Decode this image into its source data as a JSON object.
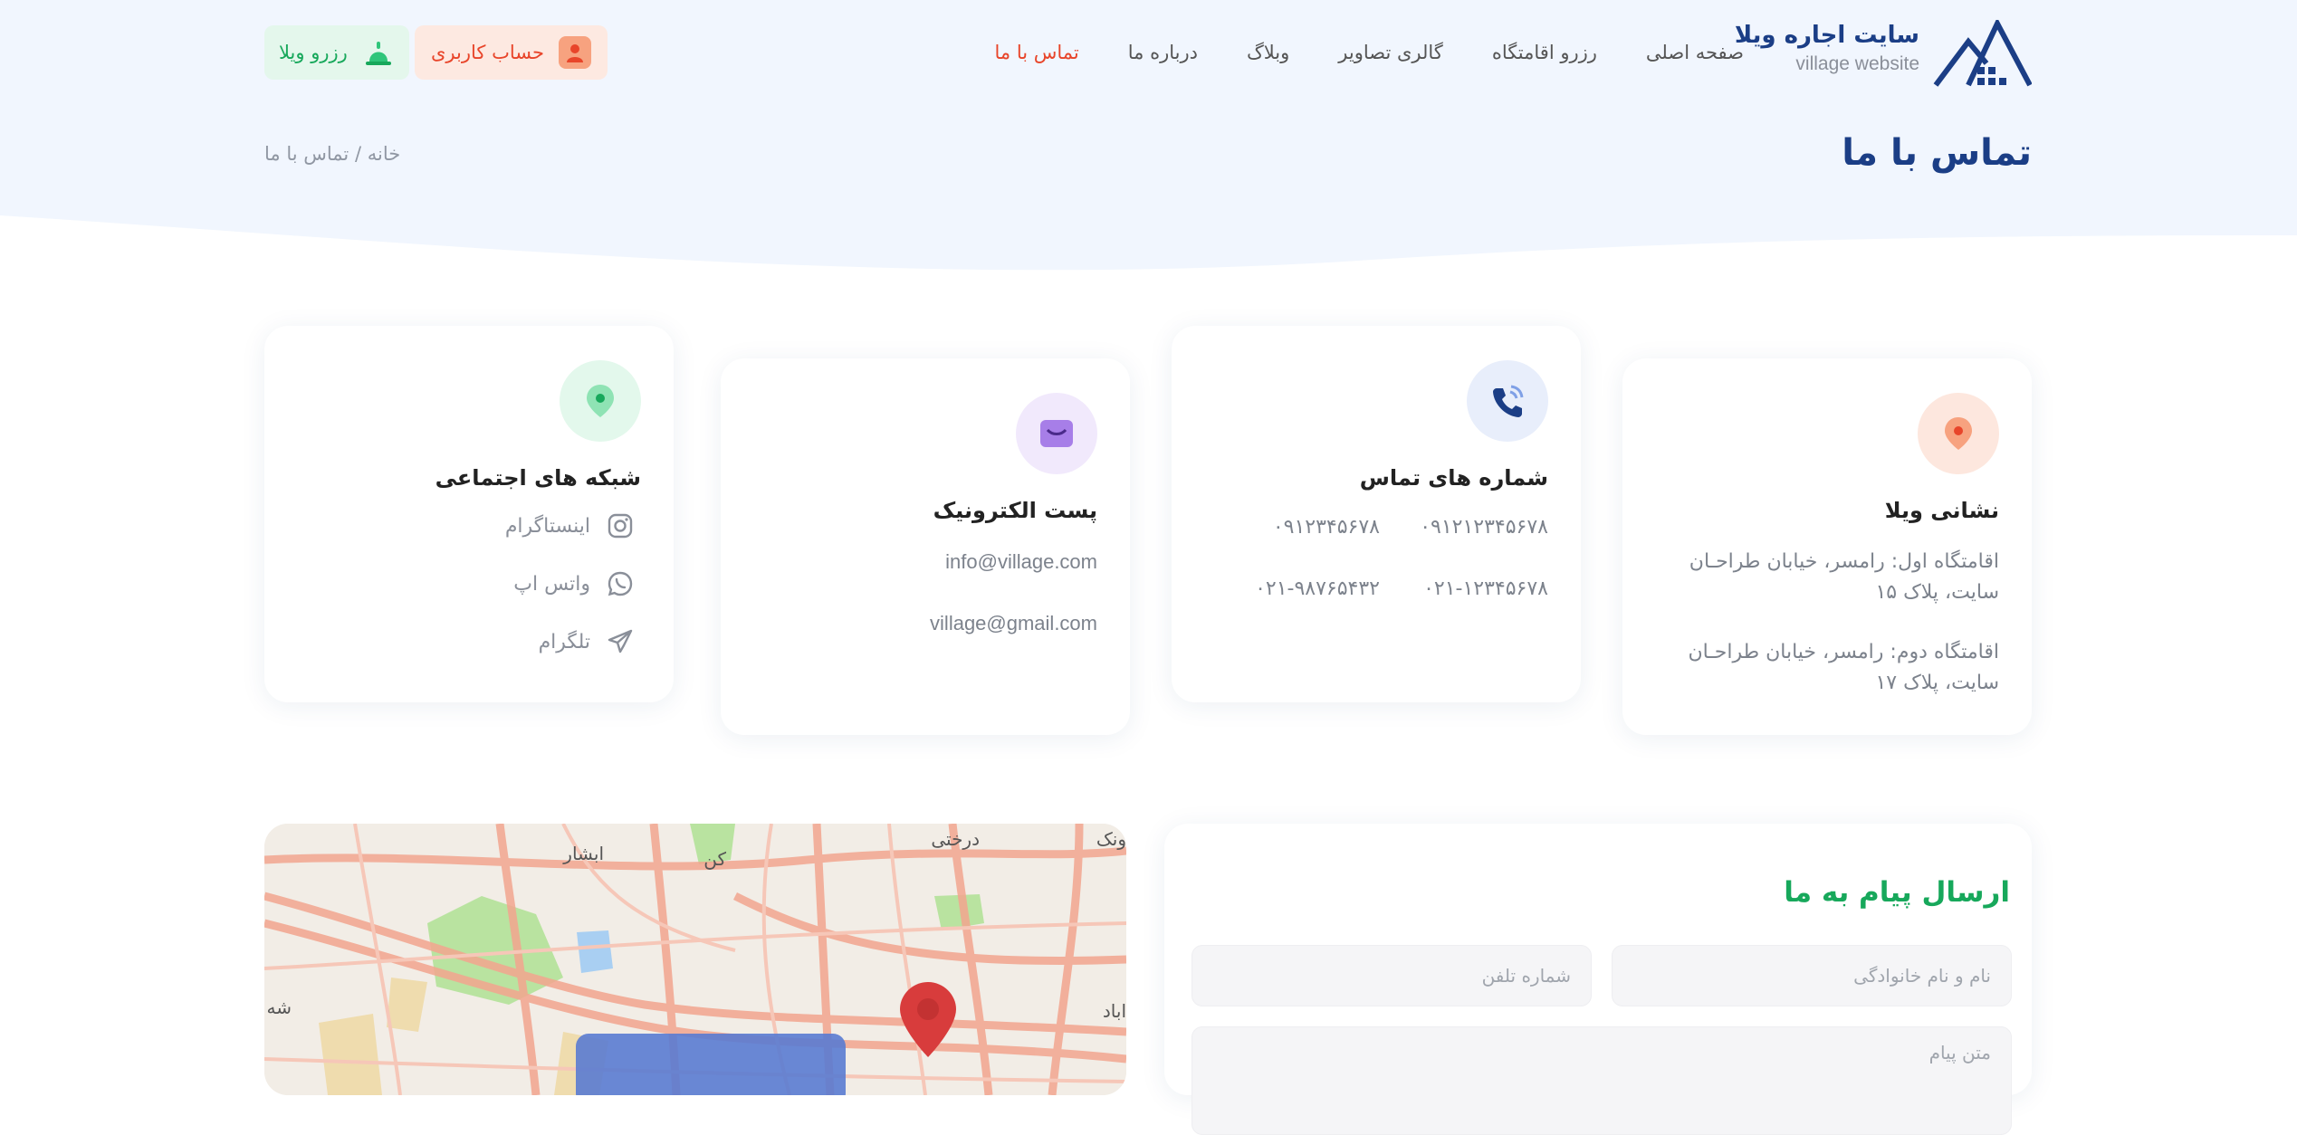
{
  "brand": {
    "title": "سایت اجاره ویلا",
    "subtitle": "village website"
  },
  "nav": {
    "items": [
      {
        "label": "صفحه اصلی",
        "active": false
      },
      {
        "label": "رزرو اقامتگاه",
        "active": false
      },
      {
        "label": "گالری تصاویر",
        "active": false
      },
      {
        "label": "وبلاگ",
        "active": false
      },
      {
        "label": "درباره ما",
        "active": false
      },
      {
        "label": "تماس با ما",
        "active": true
      }
    ],
    "account_label": "حساب کاربری",
    "reserve_label": "رزرو ویلا"
  },
  "page": {
    "title": "تماس با ما",
    "breadcrumb_home": "خانه",
    "breadcrumb_sep": "/",
    "breadcrumb_current": "تماس با ما"
  },
  "cards": {
    "address": {
      "title": "نشانی ویلا",
      "line1": "اقامتگاه اول: رامسر، خیابان طراحـان سایت، پلاک ۱۵",
      "line2": "اقامتگاه دوم: رامسر، خیابان طراحـان سایت، پلاک ۱۷"
    },
    "phones": {
      "title": "شماره های تماس",
      "numbers": [
        "۰۹۱۲۱۲۳۴۵۶۷۸",
        "۰۹۱۲۳۴۵۶۷۸",
        "۰۲۱-۱۲۳۴۵۶۷۸",
        "۰۲۱-۹۸۷۶۵۴۳۲"
      ]
    },
    "email": {
      "title": "پست الکترونیک",
      "addresses": [
        "info@village.com",
        "village@gmail.com"
      ]
    },
    "social": {
      "title": "شبکه های اجتماعی",
      "items": [
        {
          "label": "اینستاگرام",
          "icon": "instagram-icon"
        },
        {
          "label": "واتس اپ",
          "icon": "whatsapp-icon"
        },
        {
          "label": "تلگرام",
          "icon": "telegram-icon"
        }
      ]
    }
  },
  "form": {
    "title": "ارسال پیام به ما",
    "name_placeholder": "نام و نام خانوادگی",
    "phone_placeholder": "شماره تلفن",
    "message_placeholder": "متن پیام"
  },
  "map": {
    "labels": [
      "درختی",
      "کن",
      "ابشار",
      "ونک",
      "اباد",
      "شه"
    ]
  },
  "colors": {
    "primary": "#1b3e86",
    "accent_orange": "#e8452a",
    "accent_green": "#17a85b",
    "hero_bg": "#f1f6fe"
  }
}
